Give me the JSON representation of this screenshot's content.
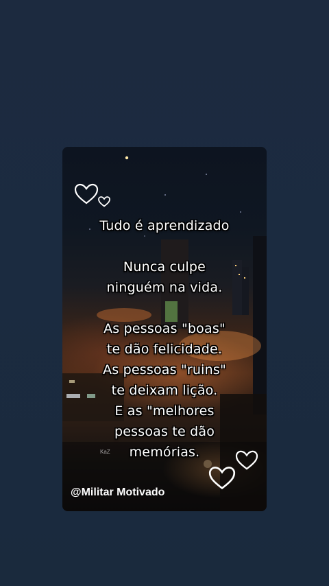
{
  "post": {
    "quote_lines": [
      "Tudo é aprendizado",
      "",
      "Nunca culpe",
      "ninguém na vida.",
      "",
      "As pessoas \"boas\"",
      "te dão felicidade.",
      "As pessoas \"ruins\"",
      "te deixam lição.",
      "E as \"melhores",
      "pessoas te dão",
      "memórias."
    ],
    "credit": "@Militar Motivado",
    "watermark": "KaZ"
  },
  "colors": {
    "page_background": "#1b2b40",
    "text": "#ffffff",
    "text_outline": "#000000"
  },
  "icons": [
    "heart-outline-icon",
    "heart-outline-icon",
    "heart-outline-icon",
    "heart-outline-icon"
  ]
}
